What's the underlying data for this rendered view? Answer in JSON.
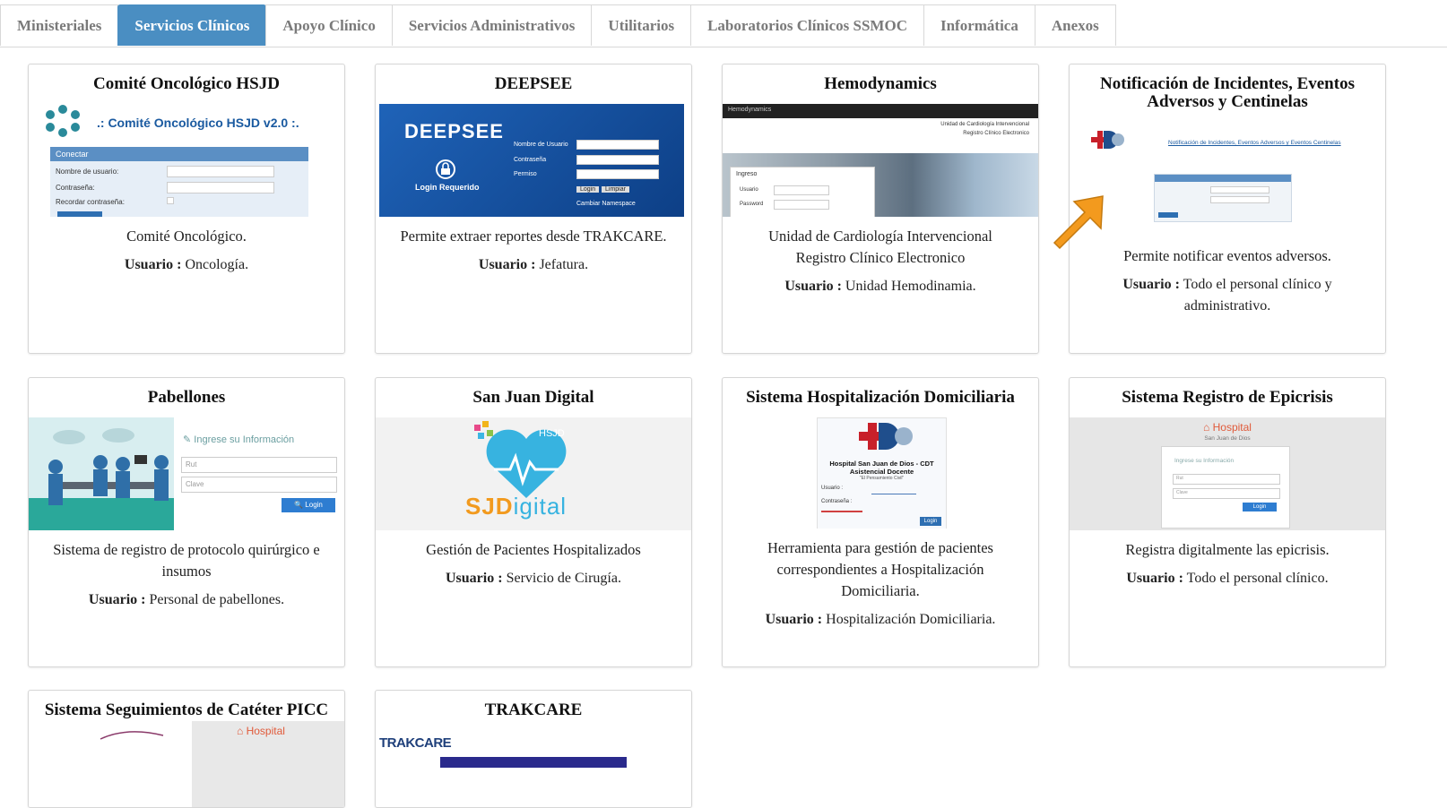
{
  "tabs": [
    {
      "label": "Ministeriales",
      "active": false
    },
    {
      "label": "Servicios Clínicos",
      "active": true
    },
    {
      "label": "Apoyo Clínico",
      "active": false
    },
    {
      "label": "Servicios Administrativos",
      "active": false
    },
    {
      "label": "Utilitarios",
      "active": false
    },
    {
      "label": "Laboratorios Clínicos SSMOC",
      "active": false
    },
    {
      "label": "Informática",
      "active": false
    },
    {
      "label": "Anexos",
      "active": false
    }
  ],
  "user_prefix": "Usuario :",
  "cards": [
    {
      "title": "Comité Oncológico HSJD",
      "description": "Comité Oncológico.",
      "user": "Oncología.",
      "thumb": {
        "header": ".: Comité Oncológico HSJD v2.0 :.",
        "panel_title": "Conectar",
        "field1": "Nombre de usuario:",
        "field2": "Contraseña:",
        "field3": "Recordar contraseña:"
      }
    },
    {
      "title": "DEEPSEE",
      "description": "Permite extraer reportes desde TRAKCARE.",
      "user": "Jefatura.",
      "thumb": {
        "logo": "DEEPSEE",
        "login": "Login Requerido",
        "field1": "Nombre de Usuario",
        "field2": "Contraseña",
        "field3": "Permiso",
        "btn1": "Login",
        "btn2": "Limpiar",
        "link": "Cambiar Namespace"
      }
    },
    {
      "title": "Hemodynamics",
      "description": "Unidad de Cardiología Intervencional Registro Clínico Electronico",
      "user": "Unidad Hemodinamia.",
      "thumb": {
        "nav": "Hemodynamics",
        "heading1": "Unidad de Cardiología Intervencional",
        "heading2": "Registro Clínico Electronico",
        "login": "Ingreso",
        "field1": "Usuario",
        "field2": "Password"
      }
    },
    {
      "title": "Notificación de Incidentes, Eventos Adversos y Centinelas",
      "description": "Permite notificar eventos adversos.",
      "user": "Todo el personal clínico y administrativo.",
      "thumb": {
        "link": "Notificación de Incidentes, Eventos Adversos y Eventos Centinelas"
      }
    },
    {
      "title": "Pabellones",
      "description": "Sistema de registro de protocolo quirúrgico e insumos",
      "user": "Personal de pabellones.",
      "thumb": {
        "prompt": "Ingrese su Información",
        "field1": "Rut",
        "field2": "Clave",
        "button": "Login"
      }
    },
    {
      "title": "San Juan Digital",
      "description": "Gestión de Pacientes Hospitalizados",
      "user": "Servicio de Cirugía.",
      "thumb": {
        "badge": "HSJD",
        "logo_sj": "SJD",
        "logo_rest": "igital"
      }
    },
    {
      "title": "Sistema Hospitalización Domiciliaria",
      "description": "Herramienta para gestión de pacientes correspondientes a Hospitalización Domiciliaria.",
      "user": "Hospitalización Domiciliaria.",
      "thumb": {
        "line1": "Hospital San Juan de Dios - CDT",
        "line2": "Asistencial Docente",
        "line3": "\"El Pensamiento Civil\"",
        "field1": "Usuario :",
        "field2": "Contraseña :",
        "button": "Login"
      }
    },
    {
      "title": "Sistema Registro de Epicrisis",
      "description": "Registra digitalmente las epicrisis.",
      "user": "Todo el personal clínico.",
      "thumb": {
        "brand": "Hospital",
        "sub": "San Juan de Dios",
        "prompt": "Ingrese su Información",
        "field1": "Rut",
        "field2": "Clave",
        "button": "Login"
      }
    },
    {
      "title": "Sistema Seguimientos de Catéter PICC",
      "description": "",
      "user": "",
      "thumb": {
        "brand": "Hospital"
      }
    },
    {
      "title": "TRAKCARE",
      "description": "",
      "user": "",
      "thumb": {
        "logo": "TRAKCARE"
      }
    }
  ],
  "colors": {
    "tab_active": "#4a8ec2",
    "arrow": "#f39a1e"
  }
}
